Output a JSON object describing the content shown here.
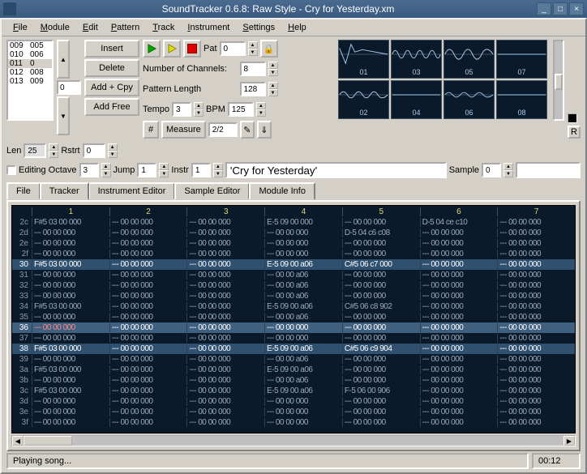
{
  "window": {
    "title": "SoundTracker 0.6.8: Raw Style - Cry for Yesterday.xm"
  },
  "menu": [
    "File",
    "Module",
    "Edit",
    "Pattern",
    "Track",
    "Instrument",
    "Settings",
    "Help"
  ],
  "songlist": [
    {
      "a": "009",
      "b": "005"
    },
    {
      "a": "010",
      "b": "006"
    },
    {
      "a": "011",
      "b": "0",
      "sel": true
    },
    {
      "a": "012",
      "b": "008"
    },
    {
      "a": "013",
      "b": "009"
    }
  ],
  "list_btns": [
    "Insert",
    "Delete",
    "Add + Cpy",
    "Add Free"
  ],
  "ctrl": {
    "pat_label": "Pat",
    "pat": "0",
    "chan_label": "Number of Channels:",
    "chan": "8",
    "plen_label": "Pattern Length",
    "plen": "128",
    "tempo_label": "Tempo",
    "tempo": "3",
    "bpm_label": "BPM",
    "bpm": "125",
    "sharp": "#",
    "measure_label": "Measure",
    "measure": "2/2"
  },
  "len_row": {
    "len": "Len",
    "len_v": "25",
    "rstrt": "Rstrt",
    "rstrt_v": "0"
  },
  "mid": {
    "editing": "Editing",
    "octave": "Octave",
    "octave_v": "3",
    "jump": "Jump",
    "jump_v": "1",
    "instr": "Instr",
    "instr_v": "1",
    "instr_name": "'Cry for Yesterday'",
    "sample": "Sample",
    "sample_v": "0",
    "sample_name": ""
  },
  "scopes": [
    "01",
    "02",
    "03",
    "04",
    "05",
    "06",
    "07",
    "08"
  ],
  "scope_r": "R",
  "tabs": [
    "File",
    "Tracker",
    "Instrument Editor",
    "Sample Editor",
    "Module Info"
  ],
  "tracker": {
    "cols": [
      "1",
      "2",
      "3",
      "4",
      "5",
      "6",
      "7"
    ],
    "rows": [
      {
        "n": "2c",
        "c": [
          "F#5 03 00 000",
          "--- 00 00 000",
          "--- 00 00 000",
          "E-5 09 00 000",
          "--- 00 00 000",
          "D-5 04 ce c10",
          "--- 00 00 000"
        ]
      },
      {
        "n": "2d",
        "c": [
          "--- 00 00 000",
          "--- 00 00 000",
          "--- 00 00 000",
          "--- 00 00 000",
          "D-5 04 c6 c08",
          "--- 00 00 000",
          "--- 00 00 000"
        ]
      },
      {
        "n": "2e",
        "c": [
          "--- 00 00 000",
          "--- 00 00 000",
          "--- 00 00 000",
          "--- 00 00 000",
          "--- 00 00 000",
          "--- 00 00 000",
          "--- 00 00 000"
        ]
      },
      {
        "n": "2f",
        "c": [
          "--- 00 00 000",
          "--- 00 00 000",
          "--- 00 00 000",
          "--- 00 00 000",
          "--- 00 00 000",
          "--- 00 00 000",
          "--- 00 00 000"
        ]
      },
      {
        "n": "30",
        "hi": 1,
        "c": [
          "F#5 03 00 000",
          "--- 00 00 000",
          "--- 00 00 000",
          "E-5 09 00 a06",
          "C#5 06 c7 000",
          "--- 00 00 000",
          "--- 00 00 000"
        ]
      },
      {
        "n": "31",
        "c": [
          "--- 00 00 000",
          "--- 00 00 000",
          "--- 00 00 000",
          "--- 00 00 a06",
          "--- 00 00 000",
          "--- 00 00 000",
          "--- 00 00 000"
        ]
      },
      {
        "n": "32",
        "c": [
          "--- 00 00 000",
          "--- 00 00 000",
          "--- 00 00 000",
          "--- 00 00 a06",
          "--- 00 00 000",
          "--- 00 00 000",
          "--- 00 00 000"
        ]
      },
      {
        "n": "33",
        "c": [
          "--- 00 00 000",
          "--- 00 00 000",
          "--- 00 00 000",
          "--- 00 00 a06",
          "--- 00 00 000",
          "--- 00 00 000",
          "--- 00 00 000"
        ]
      },
      {
        "n": "34",
        "c": [
          "F#5 03 00 000",
          "--- 00 00 000",
          "--- 00 00 000",
          "E-5 09 00 a06",
          "C#5 06 c8 902",
          "--- 00 00 000",
          "--- 00 00 000"
        ]
      },
      {
        "n": "35",
        "c": [
          "--- 00 00 000",
          "--- 00 00 000",
          "--- 00 00 000",
          "--- 00 00 a06",
          "--- 00 00 000",
          "--- 00 00 000",
          "--- 00 00 000"
        ]
      },
      {
        "n": "36",
        "cur": 1,
        "red": 1,
        "c": [
          "--- 00 00 000",
          "--- 00 00 000",
          "--- 00 00 000",
          "--- 00 00 000",
          "--- 00 00 000",
          "--- 00 00 000",
          "--- 00 00 000"
        ]
      },
      {
        "n": "37",
        "c": [
          "--- 00 00 000",
          "--- 00 00 000",
          "--- 00 00 000",
          "--- 00 00 000",
          "--- 00 00 000",
          "--- 00 00 000",
          "--- 00 00 000"
        ]
      },
      {
        "n": "38",
        "hi": 1,
        "c": [
          "F#5 03 00 000",
          "--- 00 00 000",
          "--- 00 00 000",
          "E-5 09 00 a06",
          "C#5 06 c9 904",
          "--- 00 00 000",
          "--- 00 00 000"
        ]
      },
      {
        "n": "39",
        "c": [
          "--- 00 00 000",
          "--- 00 00 000",
          "--- 00 00 000",
          "--- 00 00 a06",
          "--- 00 00 000",
          "--- 00 00 000",
          "--- 00 00 000"
        ]
      },
      {
        "n": "3a",
        "c": [
          "F#5 03 00 000",
          "--- 00 00 000",
          "--- 00 00 000",
          "E-5 09 00 a06",
          "--- 00 00 000",
          "--- 00 00 000",
          "--- 00 00 000"
        ]
      },
      {
        "n": "3b",
        "c": [
          "--- 00 00 000",
          "--- 00 00 000",
          "--- 00 00 000",
          "--- 00 00 a06",
          "--- 00 00 000",
          "--- 00 00 000",
          "--- 00 00 000"
        ]
      },
      {
        "n": "3c",
        "c": [
          "F#5 03 00 000",
          "--- 00 00 000",
          "--- 00 00 000",
          "E-5 09 00 a06",
          "F-5 06 00 906",
          "--- 00 00 000",
          "--- 00 00 000"
        ]
      },
      {
        "n": "3d",
        "c": [
          "--- 00 00 000",
          "--- 00 00 000",
          "--- 00 00 000",
          "--- 00 00 000",
          "--- 00 00 000",
          "--- 00 00 000",
          "--- 00 00 000"
        ]
      },
      {
        "n": "3e",
        "c": [
          "--- 00 00 000",
          "--- 00 00 000",
          "--- 00 00 000",
          "--- 00 00 000",
          "--- 00 00 000",
          "--- 00 00 000",
          "--- 00 00 000"
        ]
      },
      {
        "n": "3f",
        "c": [
          "--- 00 00 000",
          "--- 00 00 000",
          "--- 00 00 000",
          "--- 00 00 000",
          "--- 00 00 000",
          "--- 00 00 000",
          "--- 00 00 000"
        ]
      }
    ]
  },
  "status": {
    "msg": "Playing song...",
    "time": "00:12"
  }
}
